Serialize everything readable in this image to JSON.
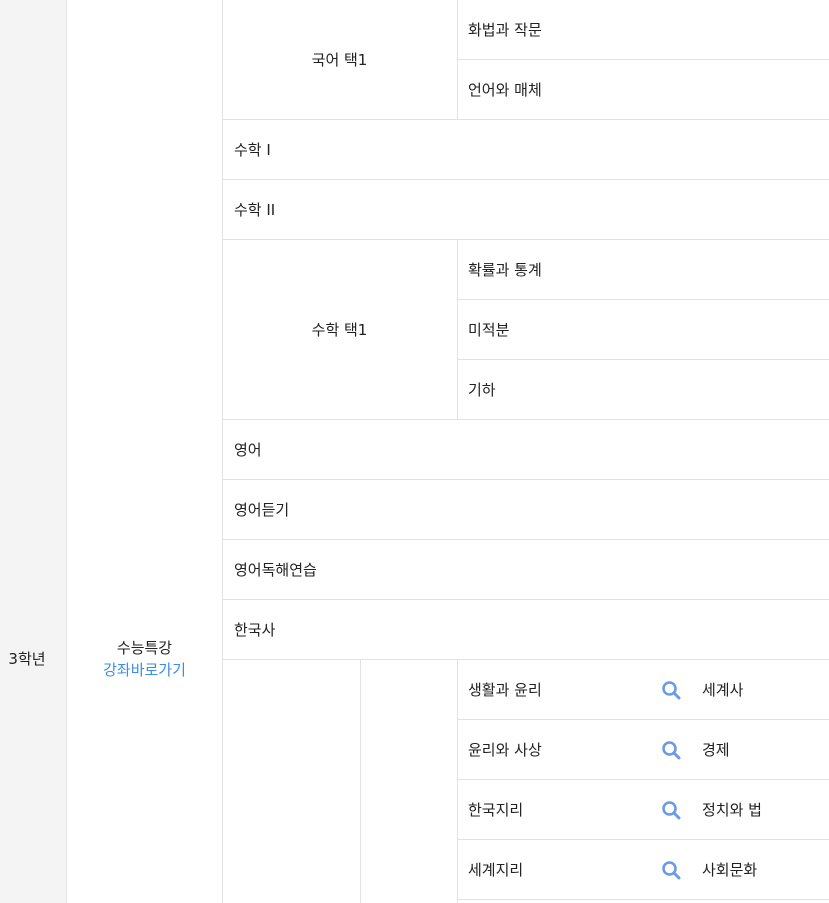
{
  "grade": {
    "label": "3학년"
  },
  "course": {
    "title": "수능특강",
    "link": "강좌바로가기"
  },
  "korean": {
    "group": "국어 택1",
    "items": [
      "화법과 작문",
      "언어와 매체"
    ]
  },
  "math1": "수학 I",
  "math2": "수학 II",
  "math_elective": {
    "group": "수학 택1",
    "items": [
      "확률과 통계",
      "미적분",
      "기하"
    ]
  },
  "english": "영어",
  "english_listening": "영어듣기",
  "english_reading": "영어독해연습",
  "korean_history": "한국사",
  "social": [
    {
      "left": "생활과 윤리",
      "right": "세계사"
    },
    {
      "left": "윤리와 사상",
      "right": "경제"
    },
    {
      "left": "한국지리",
      "right": "정치와 법"
    },
    {
      "left": "세계지리",
      "right": "사회문화"
    }
  ],
  "colors": {
    "accent": "#3b8ee8",
    "icon": "#6b9be8",
    "border": "#e2e2e2",
    "grade_bg": "#f4f4f4"
  }
}
